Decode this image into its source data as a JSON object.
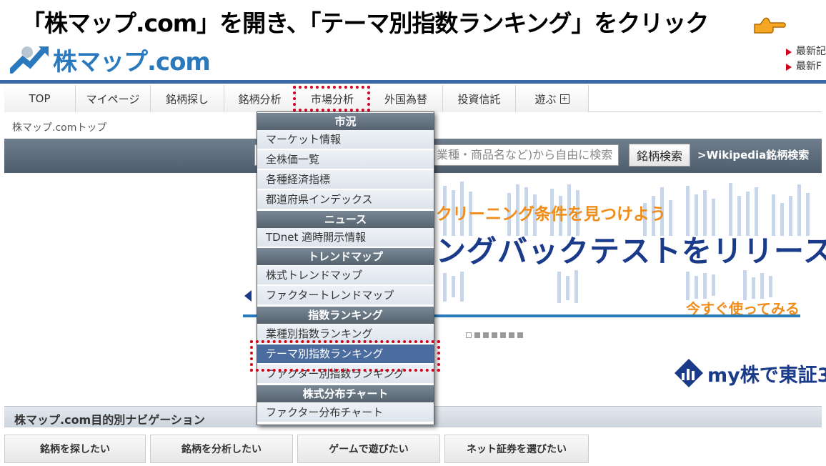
{
  "instruction": "「株マップ.com」を開き、「テーマ別指数ランキング」をクリック",
  "logo": {
    "text": "株マップ.com"
  },
  "top_links": [
    "最新記",
    "最新F"
  ],
  "nav": {
    "items": [
      "TOP",
      "マイページ",
      "銘柄探し",
      "銘柄分析",
      "市場分析",
      "外国為替",
      "投資信託",
      "遊ぶ"
    ]
  },
  "breadcrumb": "株マップ.comトップ",
  "search": {
    "value": "業種・商品名など)から自由に検索",
    "button": "銘柄検索",
    "wiki": ">Wikipedia銘柄検索"
  },
  "banner": {
    "line1": "クリーニング条件を見つけよう",
    "line2": "ングバックテストをリリース！",
    "cta": "今すぐ使ってみる"
  },
  "promo": {
    "text": "my株で東証3"
  },
  "dropdown": {
    "sections": [
      {
        "header": "市況",
        "items": [
          "マーケット情報",
          "全株価一覧",
          "各種経済指標",
          "都道府県インデックス"
        ]
      },
      {
        "header": "ニュース",
        "items": [
          "TDnet 適時開示情報"
        ]
      },
      {
        "header": "トレンドマップ",
        "items": [
          "株式トレンドマップ",
          "ファクタートレンドマップ"
        ]
      },
      {
        "header": "指数ランキング",
        "items": [
          "業種別指数ランキング",
          "テーマ別指数ランキング",
          "ファクター別指数ランキング"
        ]
      },
      {
        "header": "株式分布チャート",
        "items": [
          "ファクター分布チャート"
        ]
      }
    ],
    "selected": "テーマ別指数ランキング"
  },
  "purpose_nav": {
    "title": "株マップ.com目的別ナビゲーション",
    "buttons": [
      "銘柄を探したい",
      "銘柄を分析したい",
      "ゲームで遊びたい",
      "ネット証券を選びたい"
    ]
  },
  "colors": {
    "accent": "#2a79bd",
    "highlight": "#d0021b",
    "selected": "#4b6c9e"
  }
}
